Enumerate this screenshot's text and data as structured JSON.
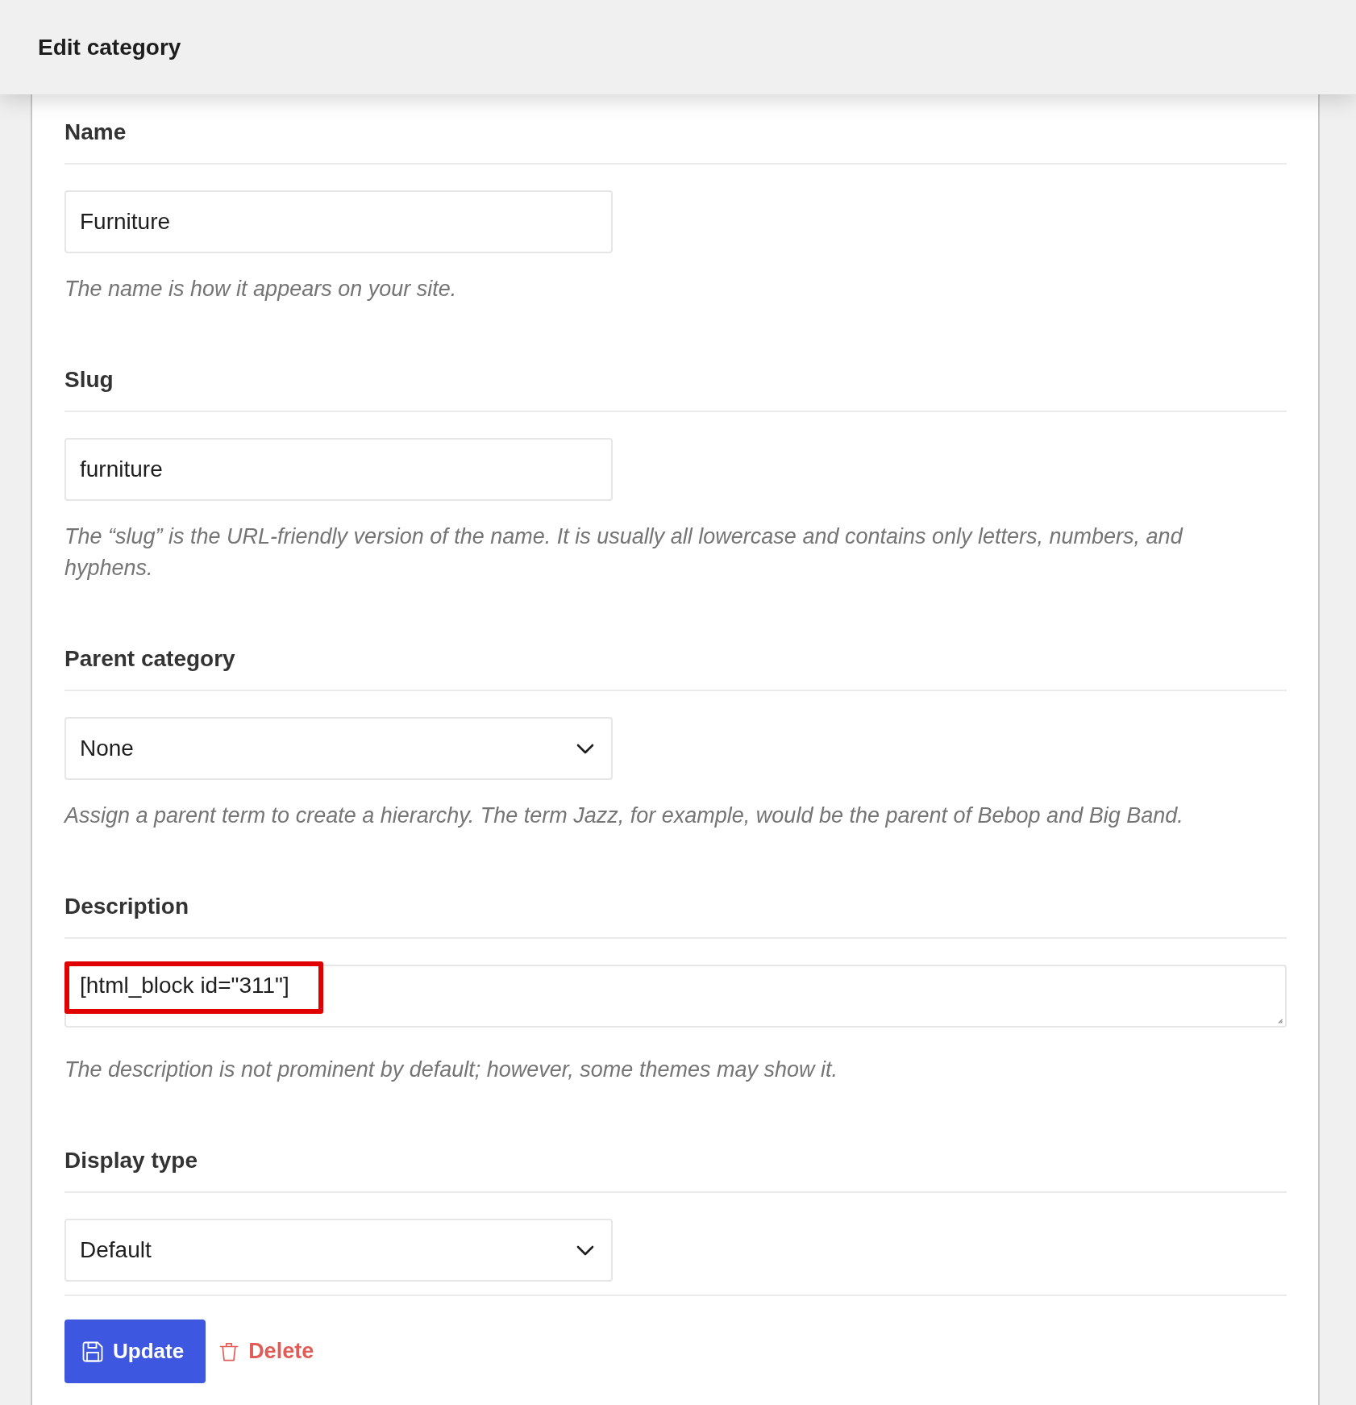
{
  "header": {
    "title": "Edit category"
  },
  "fields": [
    {
      "kind": "text",
      "label": "Name",
      "value": "Furniture",
      "highlighted": false,
      "help": "The name is how it appears on your site."
    },
    {
      "kind": "text",
      "label": "Slug",
      "value": "furniture",
      "highlighted": false,
      "help": "The “slug” is the URL-friendly version of the name. It is usually all lowercase and contains only letters, numbers, and hyphens."
    },
    {
      "kind": "select",
      "label": "Parent category",
      "value": "None",
      "highlighted": false,
      "help": "Assign a parent term to create a hierarchy. The term Jazz, for example, would be the parent of Bebop and Big Band."
    },
    {
      "kind": "textarea",
      "label": "Description",
      "value": "[html_block id=\"311\"]",
      "highlighted": true,
      "help": "The description is not prominent by default; however, some themes may show it."
    },
    {
      "kind": "select",
      "label": "Display type",
      "value": "Default",
      "highlighted": false
    }
  ],
  "actions": [
    {
      "kind": "primary",
      "label": "Update"
    },
    {
      "kind": "danger",
      "label": "Delete"
    }
  ]
}
